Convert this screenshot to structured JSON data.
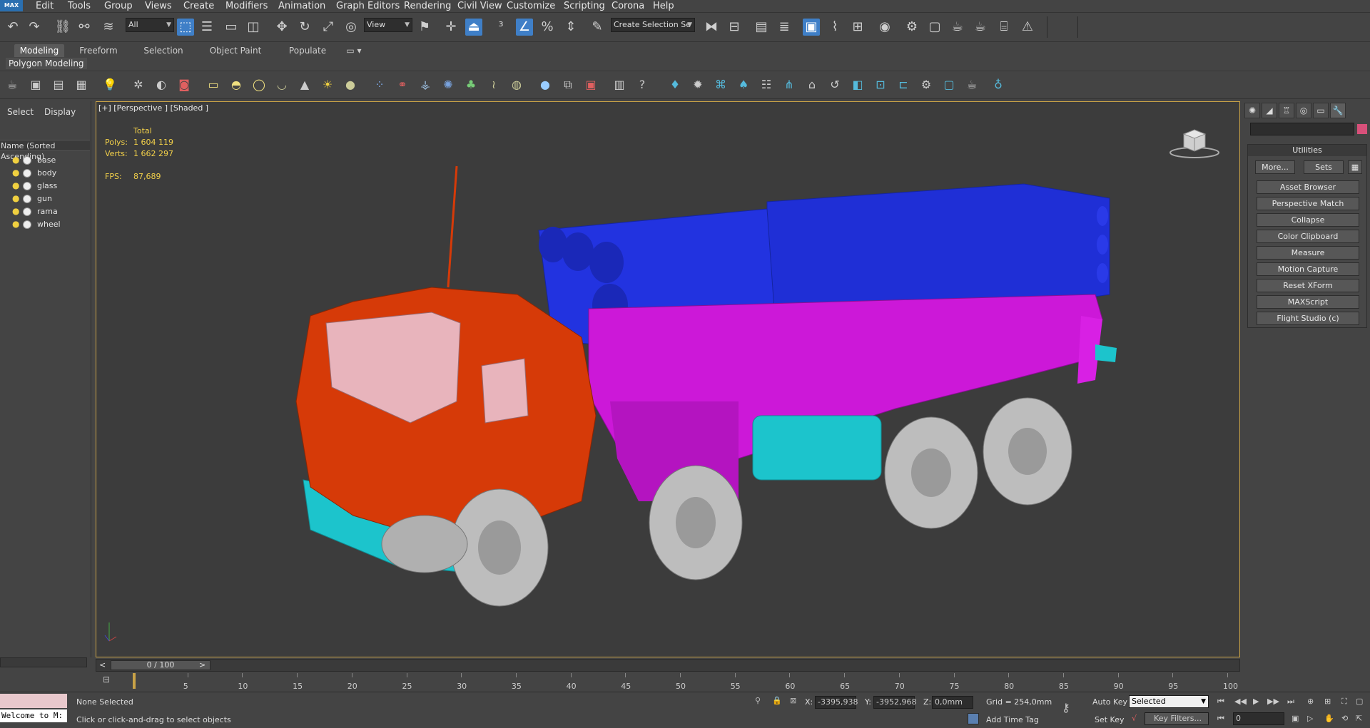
{
  "menubar": {
    "app_logo": "MAX",
    "items": [
      "Edit",
      "Tools",
      "Group",
      "Views",
      "Create",
      "Modifiers",
      "Animation",
      "Graph Editors",
      "Rendering",
      "Civil View",
      "Customize",
      "Scripting",
      "Corona",
      "Help"
    ]
  },
  "toolbar": {
    "selection_filter": "All",
    "reference_coord": "View",
    "create_selection_set": "Create Selection Se"
  },
  "ribbon": {
    "tabs": [
      "Modeling",
      "Freeform",
      "Selection",
      "Object Paint",
      "Populate"
    ],
    "active_tab": "Modeling",
    "panel_label": "Polygon Modeling"
  },
  "explorer": {
    "tabs": [
      "Select",
      "Display"
    ],
    "column_header": "Name (Sorted Ascending)",
    "objects": [
      "base",
      "body",
      "glass",
      "gun",
      "rama",
      "wheel"
    ]
  },
  "viewport": {
    "label": "[+] [Perspective ] [Shaded ]",
    "stats_total_label": "Total",
    "polys_label": "Polys:",
    "polys_value": "1 604 119",
    "verts_label": "Verts:",
    "verts_value": "1 662 297",
    "fps_label": "FPS:",
    "fps_value": "87,689",
    "model_colors": {
      "cab": "#d63a08",
      "launcher": "#1f2fd6",
      "frame": "#cc18d8",
      "base": "#1cc4cc",
      "wheels": "#bdbdbd",
      "glass": "#e8b4bc"
    }
  },
  "command_panel": {
    "rollout_title": "Utilities",
    "more_button": "More...",
    "sets_button": "Sets",
    "utility_buttons": [
      "Asset Browser",
      "Perspective Match",
      "Collapse",
      "Color Clipboard",
      "Measure",
      "Motion Capture",
      "Reset XForm",
      "MAXScript",
      "Flight Studio (c)"
    ]
  },
  "timeline": {
    "time_display": "0 / 100",
    "prev_label": "<",
    "next_label": ">",
    "ticks": [
      "5",
      "10",
      "15",
      "20",
      "25",
      "30",
      "35",
      "40",
      "45",
      "50",
      "55",
      "60",
      "65",
      "70",
      "75",
      "80",
      "85",
      "90",
      "95",
      "100"
    ]
  },
  "statusbar": {
    "maxscript_listener": "Welcome to M:",
    "selection_status": "None Selected",
    "prompt": "Click or click-and-drag to select objects",
    "x_label": "X:",
    "x_value": "-3395,938",
    "y_label": "Y:",
    "y_value": "-3952,968",
    "z_label": "Z:",
    "z_value": "0,0mm",
    "grid": "Grid = 254,0mm",
    "add_time_tag": "Add Time Tag",
    "auto_key": "Auto Key",
    "auto_key_value": "Selected",
    "set_key": "Set Key",
    "key_filters": "Key Filters...",
    "frame_value": "0"
  }
}
